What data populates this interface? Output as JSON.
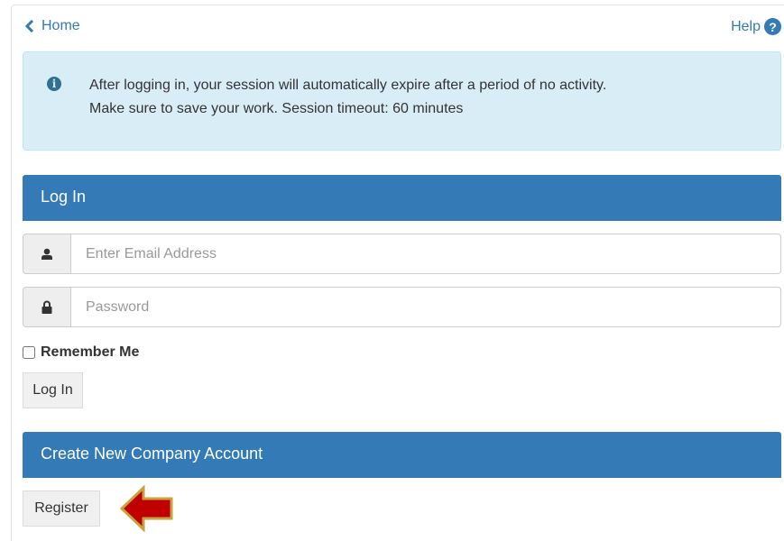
{
  "nav": {
    "home_label": "Home",
    "help_label": "Help",
    "home_icon": "chevron-left-icon",
    "help_icon": "question-circle-icon"
  },
  "alert": {
    "icon": "info-icon",
    "line1": "After logging in, your session will automatically expire after a period of no activity.",
    "line2": "Make sure to save your work. Session timeout: 60 minutes"
  },
  "login": {
    "heading": "Log In",
    "email_placeholder": "Enter Email Address",
    "password_placeholder": "Password",
    "email_value": "",
    "password_value": "",
    "remember_label": "Remember Me",
    "remember_checked": false,
    "submit_label": "Log In"
  },
  "create": {
    "heading": "Create New Company Account",
    "register_label": "Register"
  },
  "colors": {
    "primary": "#337ab7",
    "alert_bg": "#d9edf7",
    "arrow_fill": "#c00000",
    "arrow_outline": "#c8a23c"
  }
}
